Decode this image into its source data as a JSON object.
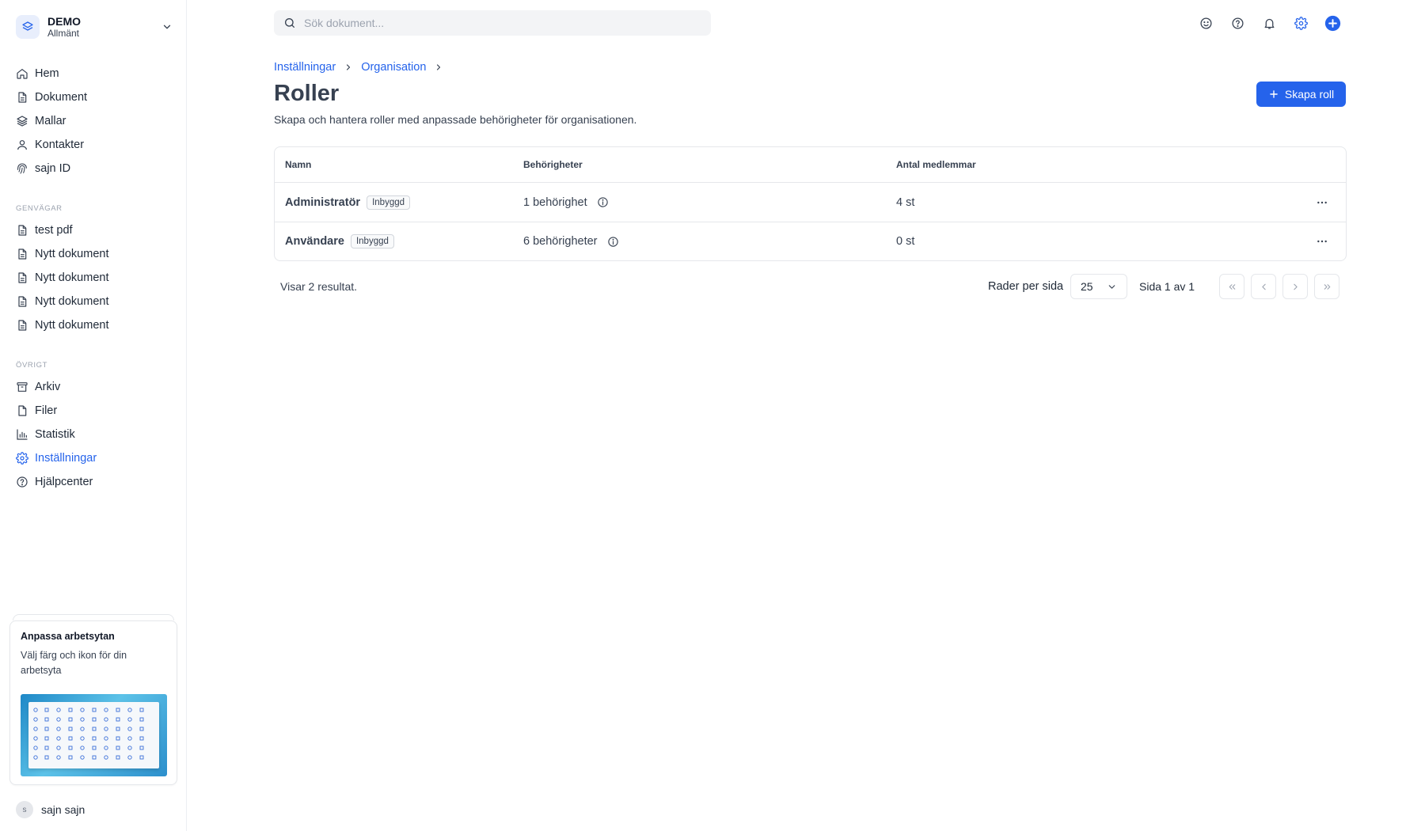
{
  "workspace": {
    "name": "DEMO",
    "subtitle": "Allmänt"
  },
  "nav": {
    "main": [
      {
        "label": "Hem",
        "icon": "home-icon"
      },
      {
        "label": "Dokument",
        "icon": "document-icon"
      },
      {
        "label": "Mallar",
        "icon": "layers-icon"
      },
      {
        "label": "Kontakter",
        "icon": "user-icon"
      },
      {
        "label": "sajn ID",
        "icon": "fingerprint-icon"
      }
    ],
    "shortcuts_label": "GENVÄGAR",
    "shortcuts": [
      {
        "label": "test pdf"
      },
      {
        "label": "Nytt dokument"
      },
      {
        "label": "Nytt dokument"
      },
      {
        "label": "Nytt dokument"
      },
      {
        "label": "Nytt dokument"
      }
    ],
    "other_label": "ÖVRIGT",
    "other": [
      {
        "label": "Arkiv",
        "icon": "archive-icon"
      },
      {
        "label": "Filer",
        "icon": "file-icon"
      },
      {
        "label": "Statistik",
        "icon": "bar-chart-icon"
      },
      {
        "label": "Inställningar",
        "icon": "gear-icon",
        "active": true
      },
      {
        "label": "Hjälpcenter",
        "icon": "help-circle-icon"
      }
    ]
  },
  "promo": {
    "title": "Anpassa arbetsytan",
    "text": "Välj färg och ikon för din arbetsyta"
  },
  "user": {
    "initial": "s",
    "name": "sajn sajn"
  },
  "search": {
    "placeholder": "Sök dokument..."
  },
  "breadcrumb": {
    "items": [
      "Inställningar",
      "Organisation"
    ]
  },
  "page": {
    "title": "Roller",
    "description": "Skapa och hantera roller med anpassade behörigheter för organisationen.",
    "create_button": "Skapa roll"
  },
  "table": {
    "headers": [
      "Namn",
      "Behörigheter",
      "Antal medlemmar"
    ],
    "rows": [
      {
        "name": "Administratör",
        "badge": "Inbyggd",
        "permissions": "1 behörighet",
        "members": "4 st"
      },
      {
        "name": "Användare",
        "badge": "Inbyggd",
        "permissions": "6 behörigheter",
        "members": "0 st"
      }
    ]
  },
  "pagination": {
    "results": "Visar 2 resultat.",
    "rows_per_page_label": "Rader per sida",
    "rows_per_page": "25",
    "page_info": "Sida 1 av 1"
  },
  "colors": {
    "accent": "#2563eb",
    "text": "#374151",
    "border": "#e5e7eb"
  }
}
